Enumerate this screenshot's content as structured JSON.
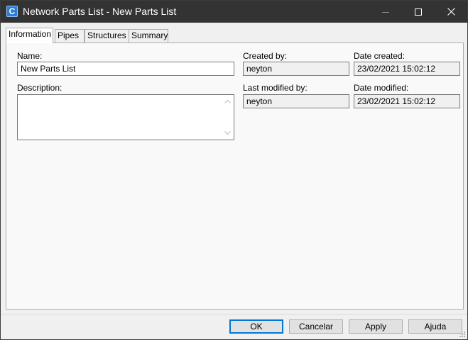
{
  "window": {
    "title": "Network Parts List - New Parts List",
    "app_icon_letter": "C"
  },
  "tabs": [
    {
      "label": "Information",
      "active": true
    },
    {
      "label": "Pipes",
      "active": false
    },
    {
      "label": "Structures",
      "active": false
    },
    {
      "label": "Summary",
      "active": false
    }
  ],
  "info": {
    "name_label": "Name:",
    "name_value": "New Parts List",
    "description_label": "Description:",
    "description_value": "",
    "created_by_label": "Created by:",
    "created_by_value": "neyton",
    "date_created_label": "Date created:",
    "date_created_value": "23/02/2021 15:02:12",
    "last_modified_by_label": "Last modified by:",
    "last_modified_by_value": "neyton",
    "date_modified_label": "Date modified:",
    "date_modified_value": "23/02/2021 15:02:12"
  },
  "buttons": {
    "ok": "OK",
    "cancel": "Cancelar",
    "apply": "Apply",
    "help": "Ajuda"
  },
  "colors": {
    "titlebar": "#333333",
    "accent": "#0078d7",
    "icon": "#2a7fd4"
  }
}
